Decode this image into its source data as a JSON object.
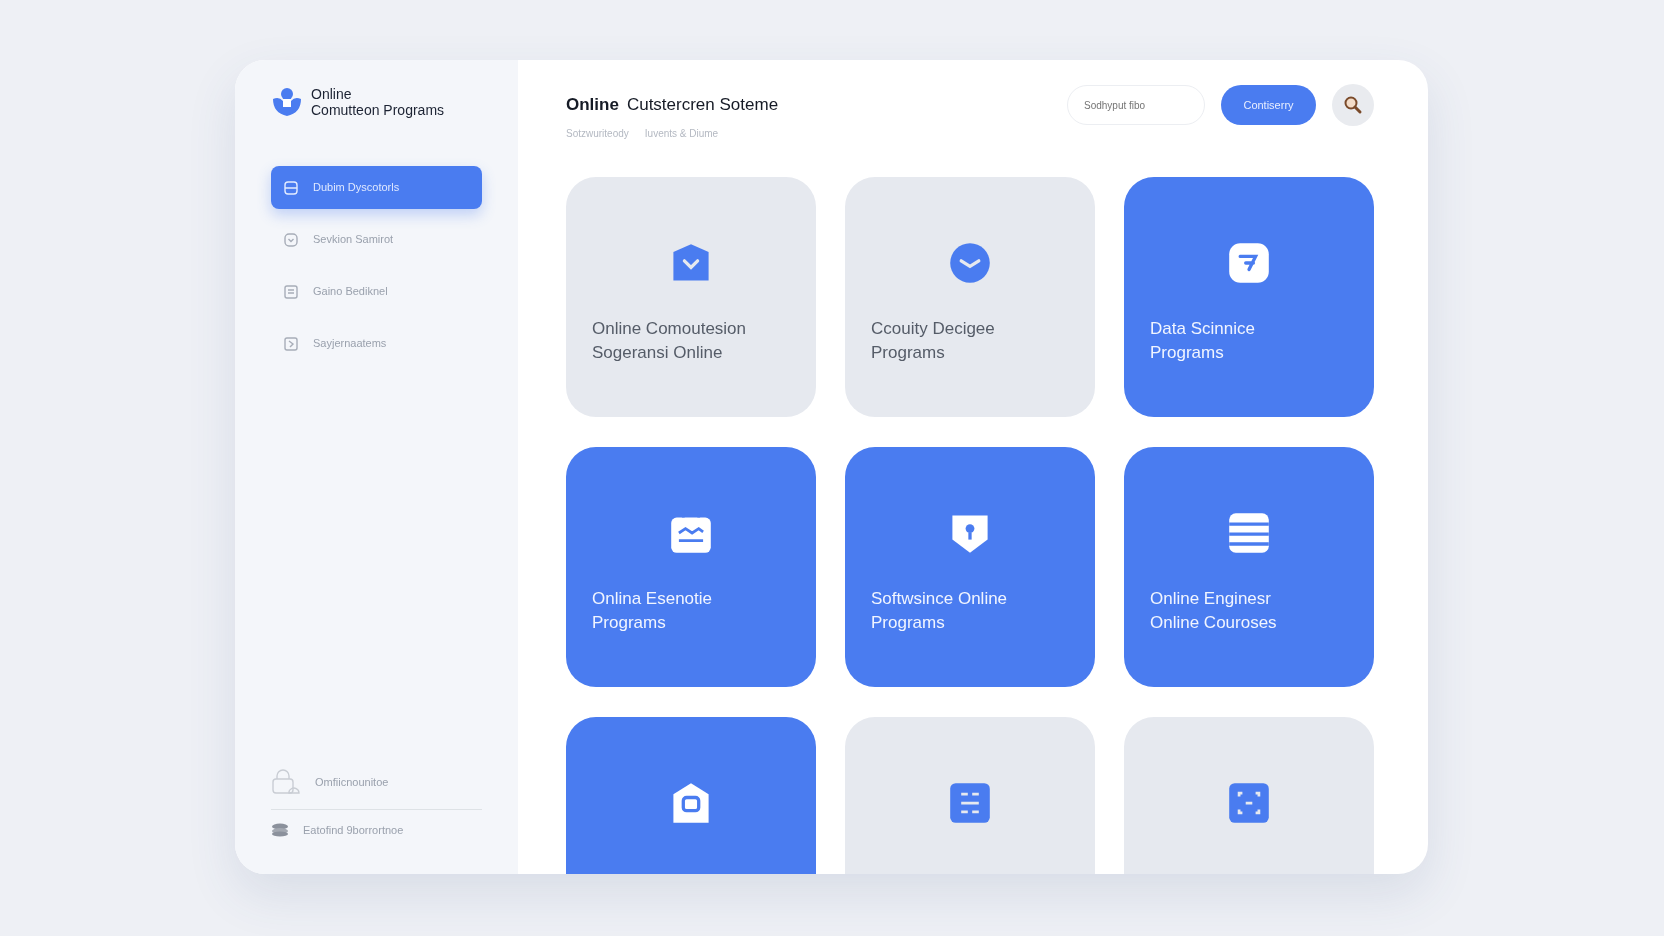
{
  "brand": {
    "name": "Online\nComutteon Programs"
  },
  "sidebar": {
    "items": [
      {
        "label": "Dubim Dyscotorls",
        "selected": true
      },
      {
        "label": "Sevkion Samirot",
        "selected": false
      },
      {
        "label": "Gaino Bediknel",
        "selected": false
      },
      {
        "label": "Sayjernaatems",
        "selected": false
      }
    ],
    "footer_items": [
      {
        "label": "Omfiicnounitoe"
      },
      {
        "label": "Eatofind 9borrortnoe"
      }
    ]
  },
  "header": {
    "title_bold": "Online",
    "title_rest": "Cutstercren Soteme",
    "breadcrumb": [
      "Sotzwuriteody",
      "Iuvents & Diume"
    ],
    "search": {
      "placeholder": "Sodhyput fibo"
    },
    "button": "Contiserry"
  },
  "cards": [
    {
      "title": "Online Comoutesion\nSogeransi Online",
      "kind": "plain"
    },
    {
      "title": "Ccouity Decigee\nPrograms",
      "kind": "plain"
    },
    {
      "title": "Data Scinnice\nPrograms",
      "kind": "accent"
    },
    {
      "title": "Onlina Esenotie\nPrograms",
      "kind": "accent"
    },
    {
      "title": "Softwsince Online\nPrograms",
      "kind": "accent"
    },
    {
      "title": "Online Enginesr\nOnline Couroses",
      "kind": "accent"
    },
    {
      "kind": "accent"
    },
    {
      "kind": "plain"
    },
    {
      "kind": "plain"
    }
  ]
}
